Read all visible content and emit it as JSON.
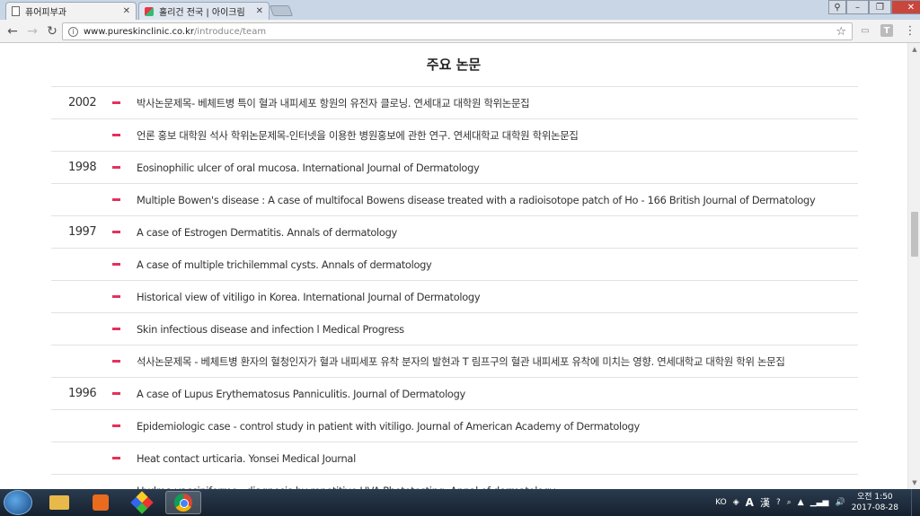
{
  "browser": {
    "tabs": [
      {
        "title": "퓨어피부과",
        "active": true
      },
      {
        "title": "홀리건 전국 | 아이크림",
        "active": false
      }
    ],
    "url_host": "www.pureskinclinic.co.kr",
    "url_path": "/introduce/team"
  },
  "page": {
    "section_title": "주요 논문",
    "accent_color": "#e4325a",
    "papers": [
      {
        "year": "2002",
        "text": "박사논문제목- 베체트병 특이 혈과 내피세포 항원의 유전자 클로닝. 연세대교 대학원 학위논문집"
      },
      {
        "year": "",
        "text": "언론 홍보 대학원 석사 학위논문제목-인터넷을 이용한 병원홍보에 관한 연구. 연세대학교 대학원 학위논문집"
      },
      {
        "year": "1998",
        "text": "Eosinophilic ulcer of oral mucosa.  International Journal of Dermatology"
      },
      {
        "year": "",
        "text": "Multiple Bowen's disease : A case of multifocal Bowens disease treated with a radioisotope patch of Ho - 166 British Journal of Dermatology"
      },
      {
        "year": "1997",
        "text": "A case of Estrogen Dermatitis. Annals of dermatology"
      },
      {
        "year": "",
        "text": "A case of multiple trichilemmal cysts. Annals of dermatology"
      },
      {
        "year": "",
        "text": "Historical view of vitiligo in Korea. International Journal of Dermatology"
      },
      {
        "year": "",
        "text": "Skin infectious disease and infection  l  Medical Progress"
      },
      {
        "year": "",
        "text": "석사논문제목 - 베체트병 환자의 혈청인자가 혈과 내피세포 유착 분자의 발현과 T 림프구의 혈관 내피세포 유착에 미치는 영향. 연세대학교 대학원 학위 논문집"
      },
      {
        "year": "1996",
        "text": "A case of Lupus Erythematosus Panniculitis.  Journal of Dermatology"
      },
      {
        "year": "",
        "text": "Epidemiologic case - control study in patient with vitiligo.  Journal of American Academy of Dermatology"
      },
      {
        "year": "",
        "text": "Heat contact urticaria. Yonsei Medical Journal"
      },
      {
        "year": "",
        "text": "Hydroa vacciniforme : diagnosis by repetitive UVA Phototesting. Annal of dermatology"
      }
    ]
  },
  "taskbar": {
    "lang": "KO",
    "ime_a": "A",
    "ime_han": "漢",
    "time": "오전 1:50",
    "date": "2017-08-28"
  },
  "icons": {
    "back": "back-arrow-icon",
    "forward": "forward-arrow-icon",
    "reload": "reload-icon",
    "info": "info-icon",
    "star": "bookmark-star-icon"
  }
}
